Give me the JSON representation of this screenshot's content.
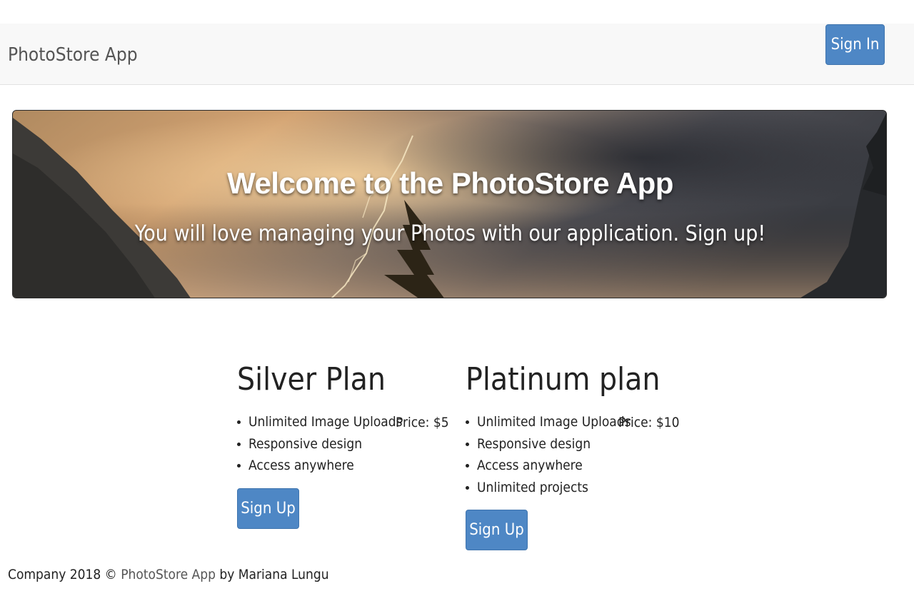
{
  "navbar": {
    "brand": "PhotoStore App",
    "signin_label": "Sign In"
  },
  "hero": {
    "title": "Welcome to the PhotoStore App",
    "subtitle": "You will love managing your Photos with our application. Sign up!"
  },
  "plans": [
    {
      "name": "Silver Plan",
      "price": "Price: $5",
      "features": [
        "Unlimited Image Uploads",
        "Responsive design",
        "Access anywhere"
      ],
      "signup_label": "Sign Up"
    },
    {
      "name": "Platinum plan",
      "price": "Price: $10",
      "features": [
        "Unlimited Image Uploads",
        "Responsive design",
        "Access anywhere",
        "Unlimited projects"
      ],
      "signup_label": "Sign Up"
    }
  ],
  "footer": {
    "prefix": "Company 2018 ©",
    "link": "PhotoStore App",
    "suffix": "by Mariana Lungu"
  },
  "colors": {
    "button": "#4e87c5",
    "navbar_bg": "#f8f8f8",
    "brand_text": "#555555"
  }
}
